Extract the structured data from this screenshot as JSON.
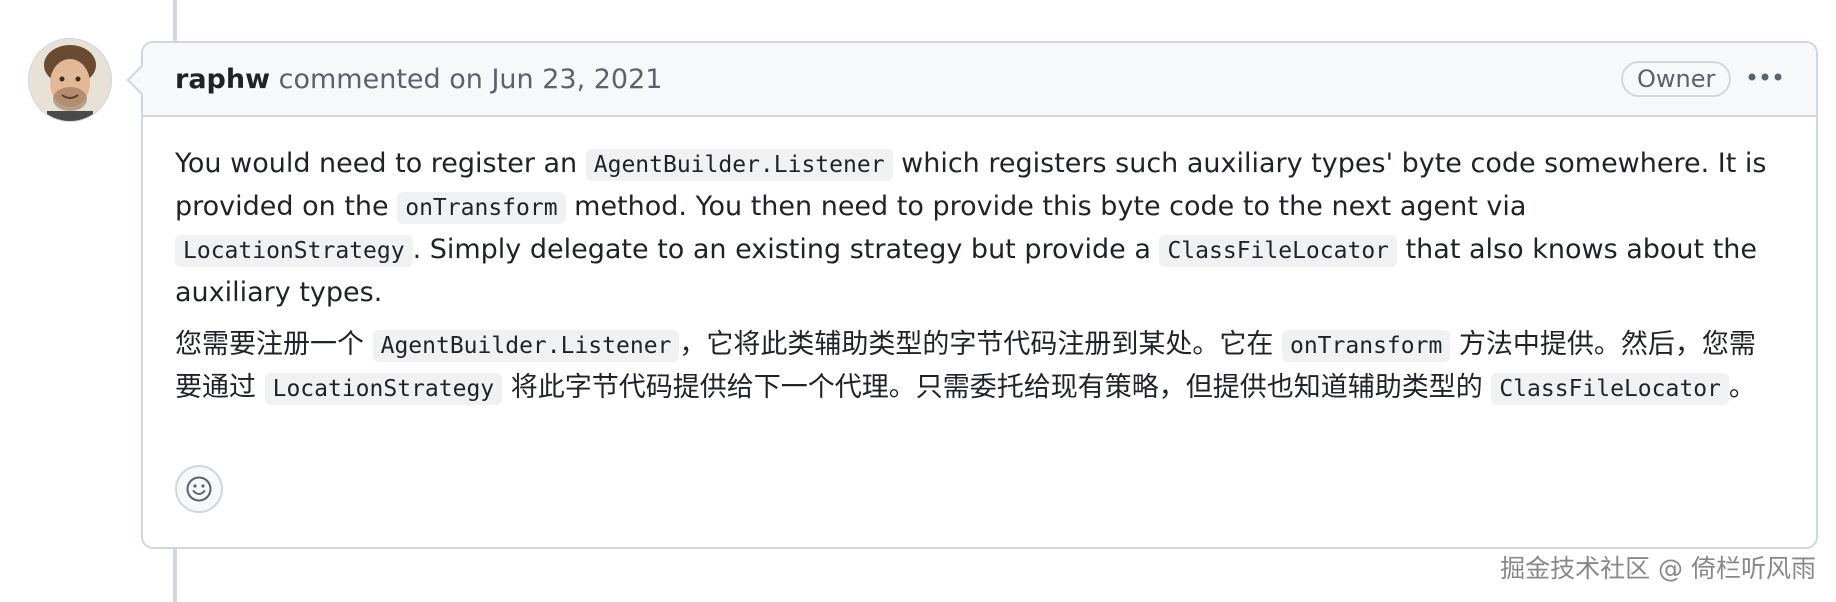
{
  "comment": {
    "author": "raphw",
    "action_text": "commented on Jun 23, 2021",
    "badge": "Owner",
    "paragraph_en": {
      "t1": "You would need to register an ",
      "c1": "AgentBuilder.Listener",
      "t2": " which registers such auxiliary types' byte code somewhere. It is provided on the ",
      "c2": "onTransform",
      "t3": " method. You then need to provide this byte code to the next agent via ",
      "c3": "LocationStrategy",
      "t4": ". Simply delegate to an existing strategy but provide a ",
      "c4": "ClassFileLocator",
      "t5": " that also knows about the auxiliary types."
    },
    "paragraph_cn": {
      "t1": "您需要注册一个 ",
      "c1": "AgentBuilder.Listener",
      "t2": "，它将此类辅助类型的字节代码注册到某处。它在 ",
      "c2": "onTransform",
      "t3": " 方法中提供。然后，您需要通过 ",
      "c3": "LocationStrategy",
      "t4": " 将此字节代码提供给下一个代理。只需委托给现有策略，但提供也知道辅助类型的 ",
      "c4": "ClassFileLocator",
      "t5": "。"
    }
  },
  "icons": {
    "more": "kebab-horizontal-icon",
    "reaction": "smiley-icon"
  },
  "watermark": "掘金技术社区 @ 倚栏听风雨",
  "colors": {
    "border": "#d0d7de",
    "header_bg": "#f6f8fa",
    "muted_text": "#59636e",
    "code_bg": "#eff1f3"
  }
}
